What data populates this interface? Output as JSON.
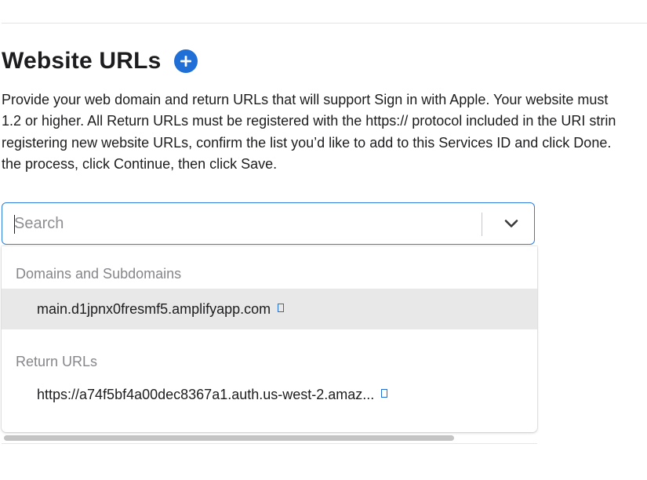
{
  "section": {
    "title": "Website URLs",
    "add_icon": "plus-circle-icon",
    "accent_color": "#1f6fd6"
  },
  "description": {
    "lines": [
      "Provide your web domain and return URLs that will support Sign in with Apple. Your website must",
      "1.2 or higher. All Return URLs must be registered with the https:// protocol included in the URI strin",
      "registering new website URLs, confirm the list you’d like to add to this Services ID and click Done.",
      "the process, click Continue, then click Save."
    ]
  },
  "search": {
    "placeholder": "Search",
    "value": "",
    "toggle_icon": "chevron-down-icon"
  },
  "dropdown": {
    "groups": [
      {
        "label": "Domains and Subdomains",
        "options": [
          {
            "text": "main.d1jpnx0fresmf5.amplifyapp.com",
            "icon": "external-link-icon",
            "highlighted": true
          }
        ]
      },
      {
        "label": "Return URLs",
        "options": [
          {
            "text": "https://a74f5bf4a00dec8367a1.auth.us-west-2.amaz...",
            "icon": "external-link-icon",
            "highlighted": false
          }
        ]
      }
    ]
  }
}
